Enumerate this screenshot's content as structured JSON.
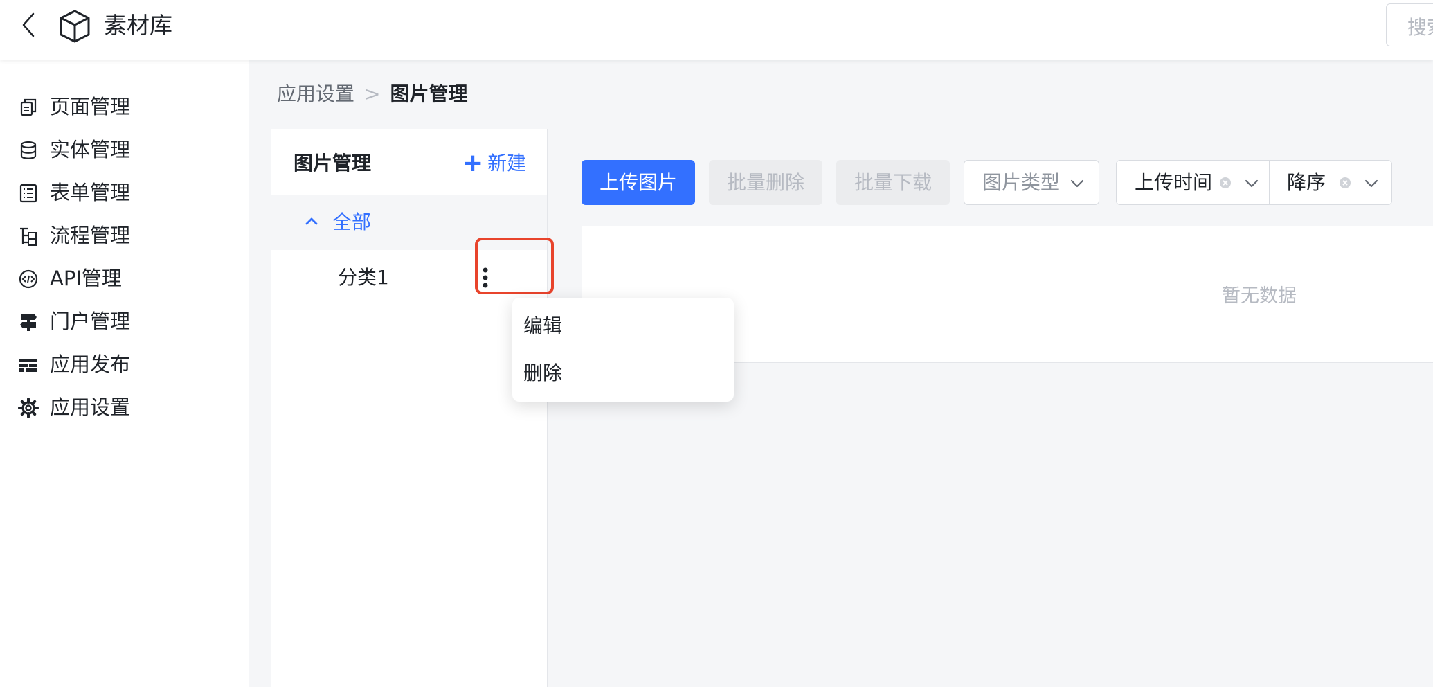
{
  "header": {
    "back_icon": "chevron-left-icon",
    "logo_icon": "cube-icon",
    "title": "素材库",
    "search_placeholder": "搜索"
  },
  "sidebar": {
    "items": [
      {
        "label": "页面管理",
        "icon": "pages-icon"
      },
      {
        "label": "实体管理",
        "icon": "database-icon"
      },
      {
        "label": "表单管理",
        "icon": "form-icon"
      },
      {
        "label": "流程管理",
        "icon": "flow-icon"
      },
      {
        "label": "API管理",
        "icon": "api-icon"
      },
      {
        "label": "门户管理",
        "icon": "signpost-icon"
      },
      {
        "label": "应用发布",
        "icon": "publish-icon"
      },
      {
        "label": "应用设置",
        "icon": "gear-icon"
      }
    ]
  },
  "breadcrumb": {
    "parent": "应用设置",
    "separator": ">",
    "current": "图片管理"
  },
  "category_panel": {
    "title": "图片管理",
    "new_label": "新建",
    "all_label": "全部",
    "items": [
      {
        "label": "分类1"
      }
    ]
  },
  "context_menu": {
    "items": [
      "编辑",
      "删除"
    ]
  },
  "toolbar": {
    "upload_label": "上传图片",
    "batch_delete_label": "批量删除",
    "batch_download_label": "批量下载",
    "type_filter_placeholder": "图片类型",
    "time_sort_value": "上传时间",
    "order_value": "降序"
  },
  "content": {
    "empty_text": "暂无数据"
  },
  "colors": {
    "accent": "#3370ff",
    "highlight": "#e8442c",
    "background": "#f5f6f8"
  }
}
